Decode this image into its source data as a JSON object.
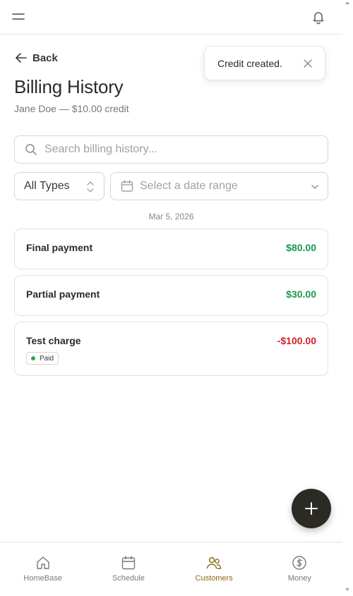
{
  "header": {
    "menu_icon": "menu-icon",
    "notification_icon": "bell-icon"
  },
  "back": {
    "label": "Back"
  },
  "page": {
    "title": "Billing History",
    "subtitle": "Jane Doe — $10.00 credit"
  },
  "toast": {
    "message": "Credit created."
  },
  "search": {
    "placeholder": "Search billing history...",
    "value": ""
  },
  "filters": {
    "type_selected": "All Types",
    "date_placeholder": "Select a date range"
  },
  "date_group": "Mar 5, 2026",
  "transactions": [
    {
      "title": "Final payment",
      "amount": "$80.00",
      "kind": "positive"
    },
    {
      "title": "Partial payment",
      "amount": "$30.00",
      "kind": "positive"
    },
    {
      "title": "Test charge",
      "amount": "-$100.00",
      "kind": "negative",
      "badge": "Paid"
    }
  ],
  "nav": {
    "items": [
      {
        "label": "HomeBase",
        "icon": "home-icon",
        "active": false
      },
      {
        "label": "Schedule",
        "icon": "calendar-icon",
        "active": false
      },
      {
        "label": "Customers",
        "icon": "users-icon",
        "active": true
      },
      {
        "label": "Money",
        "icon": "dollar-icon",
        "active": false
      }
    ]
  },
  "colors": {
    "accent": "#8a6a12",
    "positive": "#1a9a4a",
    "negative": "#d4202a",
    "fab": "#2b2a24"
  }
}
